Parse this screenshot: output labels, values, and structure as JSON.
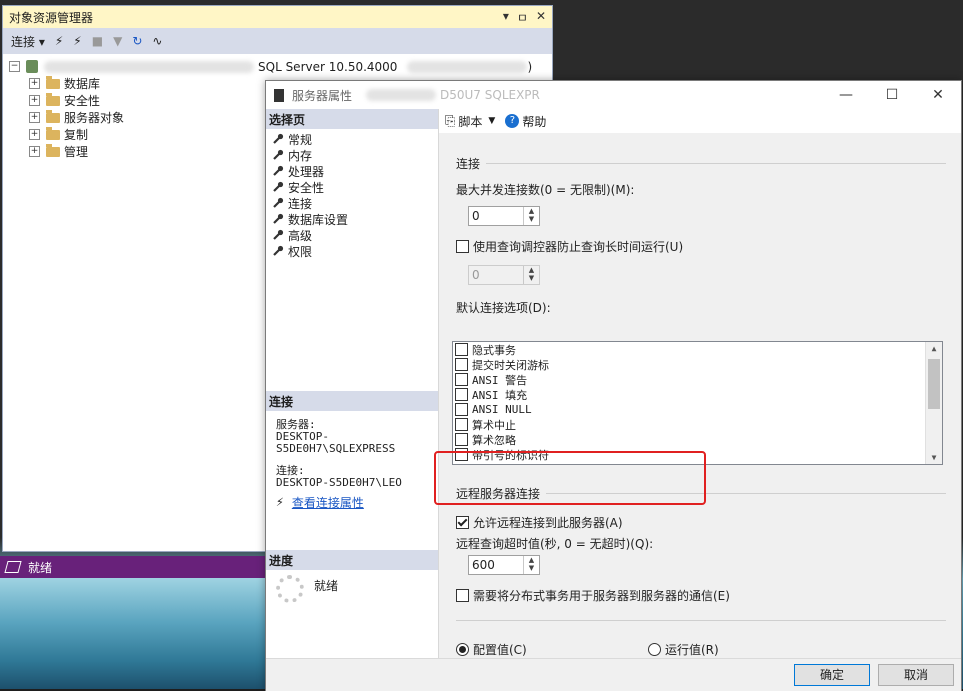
{
  "object_explorer": {
    "title": "对象资源管理器",
    "toolbar_connect": "连接",
    "server_label": "SQL Server 10.50.4000",
    "server_suffix": ")",
    "nodes": [
      "数据库",
      "安全性",
      "服务器对象",
      "复制",
      "管理"
    ],
    "status": "就绪"
  },
  "dialog": {
    "title": "服务器属性",
    "title_suffix": "D50U7 SQLEXPR",
    "select_page_header": "选择页",
    "pages": [
      "常规",
      "内存",
      "处理器",
      "安全性",
      "连接",
      "数据库设置",
      "高级",
      "权限"
    ],
    "connection_header": "连接",
    "server_label": "服务器:",
    "server_value": "DESKTOP-S5DE0H7\\SQLEXPRESS",
    "connection_label": "连接:",
    "connection_value": "DESKTOP-S5DE0H7\\LEO",
    "view_connection_link": "查看连接属性",
    "progress_header": "进度",
    "progress_status": "就绪",
    "toolbar_script": "脚本",
    "toolbar_help": "帮助",
    "section_connection": "连接",
    "max_connections_label": "最大并发连接数(0 = 无限制)(M):",
    "max_connections_value": "0",
    "use_governor_label": "使用查询调控器防止查询长时间运行(U)",
    "governor_value": "0",
    "default_options_label": "默认连接选项(D):",
    "default_options": [
      "隐式事务",
      "提交时关闭游标",
      "ANSI 警告",
      "ANSI 填充",
      "ANSI NULL",
      "算术中止",
      "算术忽略",
      "带引号的标识符"
    ],
    "section_remote": "远程服务器连接",
    "allow_remote_label": "允许远程连接到此服务器(A)",
    "allow_remote_checked": true,
    "remote_timeout_label": "远程查询超时值(秒, 0 = 无超时)(Q):",
    "remote_timeout_value": "600",
    "distributed_tx_label": "需要将分布式事务用于服务器到服务器的通信(E)",
    "radio_config": "配置值(C)",
    "radio_running": "运行值(R)",
    "ok": "确定",
    "cancel": "取消"
  },
  "colors": {
    "accent": "#68217a",
    "highlight": "#e02020",
    "link": "#1a57c4"
  }
}
